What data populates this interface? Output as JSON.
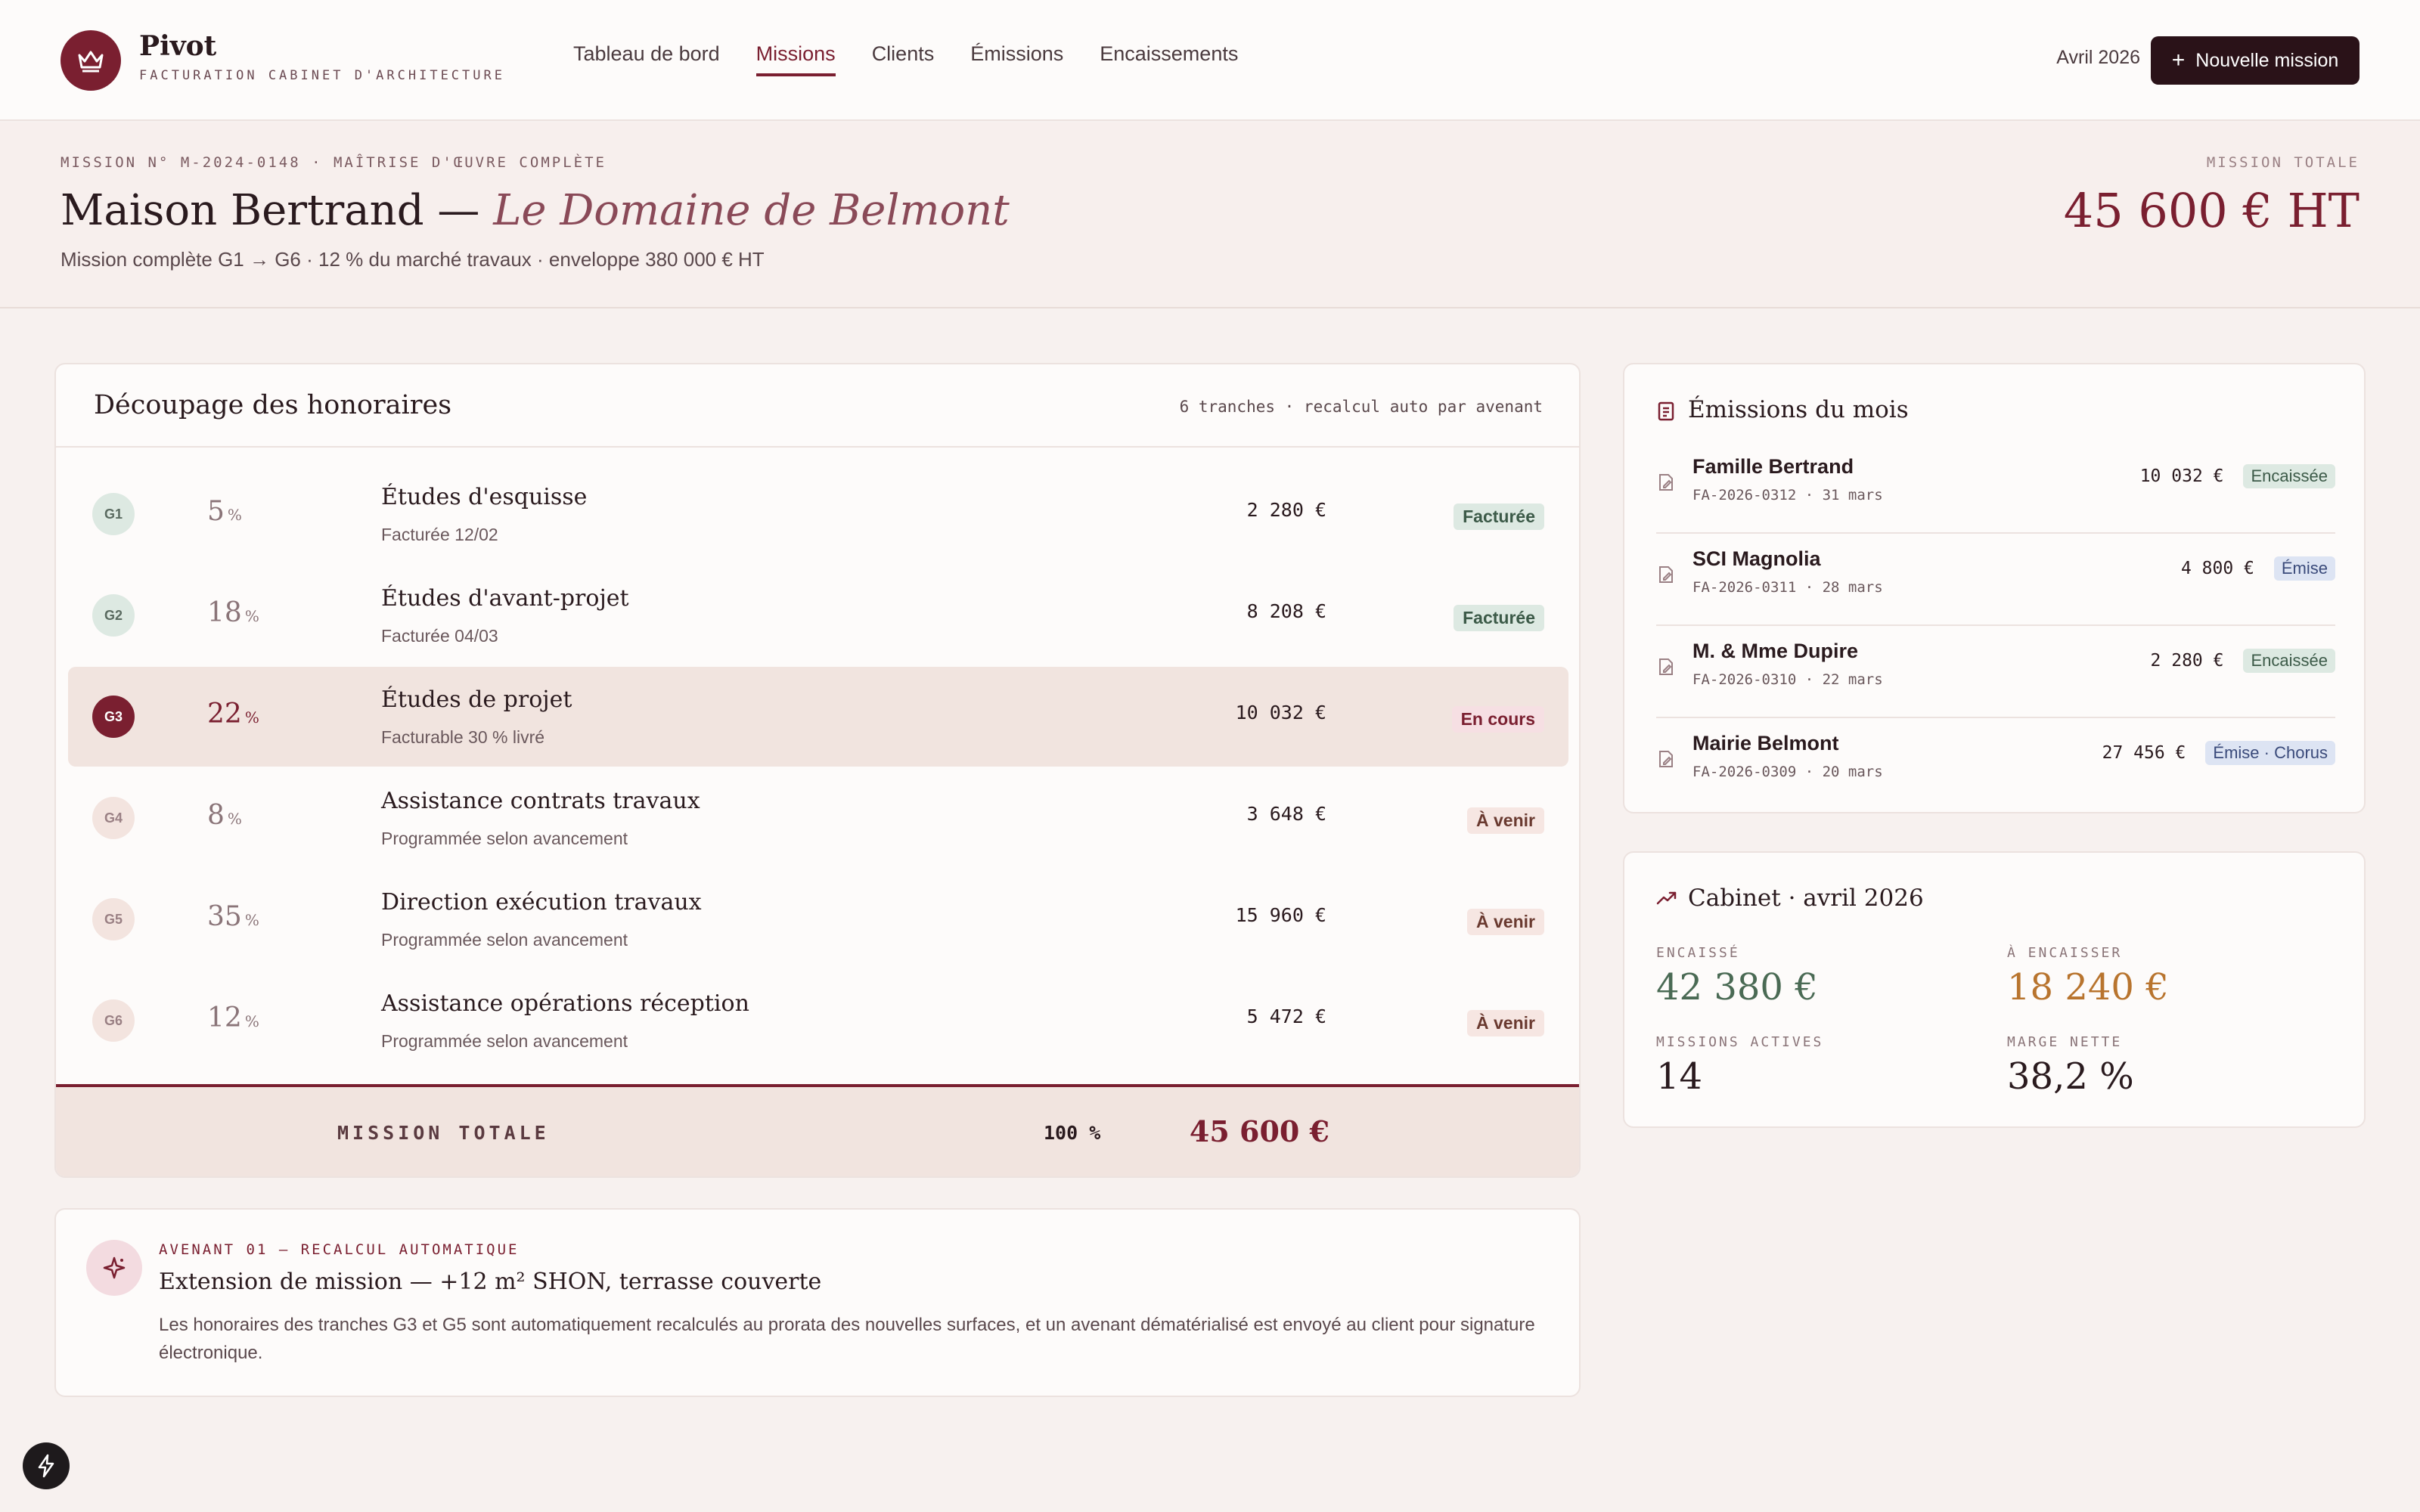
{
  "brand": {
    "name": "Pivot",
    "tagline": "FACTURATION CABINET D'ARCHITECTURE"
  },
  "nav": {
    "items": [
      {
        "label": "Tableau de bord",
        "active": false
      },
      {
        "label": "Missions",
        "active": true
      },
      {
        "label": "Clients",
        "active": false
      },
      {
        "label": "Émissions",
        "active": false
      },
      {
        "label": "Encaissements",
        "active": false
      }
    ]
  },
  "header": {
    "period": "Avril 2026",
    "new_mission_label": "Nouvelle mission"
  },
  "mission": {
    "eyebrow": "MISSION N° M-2024-0148 · MAÎTRISE D'ŒUVRE COMPLÈTE",
    "client": "Maison Bertrand —",
    "project": "Le Domaine de Belmont",
    "subtitle": "Mission complète G1 → G6 · 12 % du marché travaux · enveloppe 380 000 € HT",
    "total_label": "MISSION TOTALE",
    "total": "45 600 € HT"
  },
  "fees": {
    "title": "Découpage des honoraires",
    "meta": "6 tranches · recalcul auto par avenant",
    "tranches": [
      {
        "code": "G1",
        "pct": "5",
        "unit": "%",
        "name": "Études d'esquisse",
        "note": "Facturée 12/02",
        "amount": "2 280 €",
        "status": "Facturée"
      },
      {
        "code": "G2",
        "pct": "18",
        "unit": "%",
        "name": "Études d'avant-projet",
        "note": "Facturée 04/03",
        "amount": "8 208 €",
        "status": "Facturée"
      },
      {
        "code": "G3",
        "pct": "22",
        "unit": "%",
        "name": "Études de projet",
        "note": "Facturable 30 % livré",
        "amount": "10 032 €",
        "status": "En cours"
      },
      {
        "code": "G4",
        "pct": "8",
        "unit": "%",
        "name": "Assistance contrats travaux",
        "note": "Programmée selon avancement",
        "amount": "3 648 €",
        "status": "À venir"
      },
      {
        "code": "G5",
        "pct": "35",
        "unit": "%",
        "name": "Direction exécution travaux",
        "note": "Programmée selon avancement",
        "amount": "15 960 €",
        "status": "À venir"
      },
      {
        "code": "G6",
        "pct": "12",
        "unit": "%",
        "name": "Assistance opérations réception",
        "note": "Programmée selon avancement",
        "amount": "5 472 €",
        "status": "À venir"
      }
    ],
    "total_label": "MISSION TOTALE",
    "total_pct": "100 %",
    "total_amount": "45 600 €"
  },
  "avenant": {
    "eyebrow": "AVENANT 01 — RECALCUL AUTOMATIQUE",
    "title": "Extension de mission — +12 m² SHON, terrasse couverte",
    "text": "Les honoraires des tranches G3 et G5 sont automatiquement recalculés au prorata des nouvelles surfaces, et un avenant dématérialisé est envoyé au client pour signature électronique."
  },
  "emissions": {
    "title": "Émissions du mois",
    "items": [
      {
        "client": "Famille Bertrand",
        "ref": "FA-2026-0312 · 31 mars",
        "amount": "10 032 €",
        "status": "Encaissée"
      },
      {
        "client": "SCI Magnolia",
        "ref": "FA-2026-0311 · 28 mars",
        "amount": "4 800 €",
        "status": "Émise"
      },
      {
        "client": "M. & Mme Dupire",
        "ref": "FA-2026-0310 · 22 mars",
        "amount": "2 280 €",
        "status": "Encaissée"
      },
      {
        "client": "Mairie Belmont",
        "ref": "FA-2026-0309 · 20 mars",
        "amount": "27 456 €",
        "status": "Émise · Chorus"
      }
    ]
  },
  "cabinet": {
    "title": "Cabinet · avril 2026",
    "kpis": [
      {
        "label": "ENCAISSÉ",
        "value": "42 380 €",
        "color": "#4a6a54"
      },
      {
        "label": "À ENCAISSER",
        "value": "18 240 €",
        "color": "#b8742e"
      },
      {
        "label": "MISSIONS ACTIVES",
        "value": "14",
        "color": "#2a1a1e"
      },
      {
        "label": "MARGE NETTE",
        "value": "38,2 %",
        "color": "#2a1a1e"
      }
    ]
  },
  "colors": {
    "accent": "#7a1f30",
    "dark_button": "#2a1218",
    "paid_green": "#dde9e2",
    "issued_blue": "#dde4f3"
  }
}
